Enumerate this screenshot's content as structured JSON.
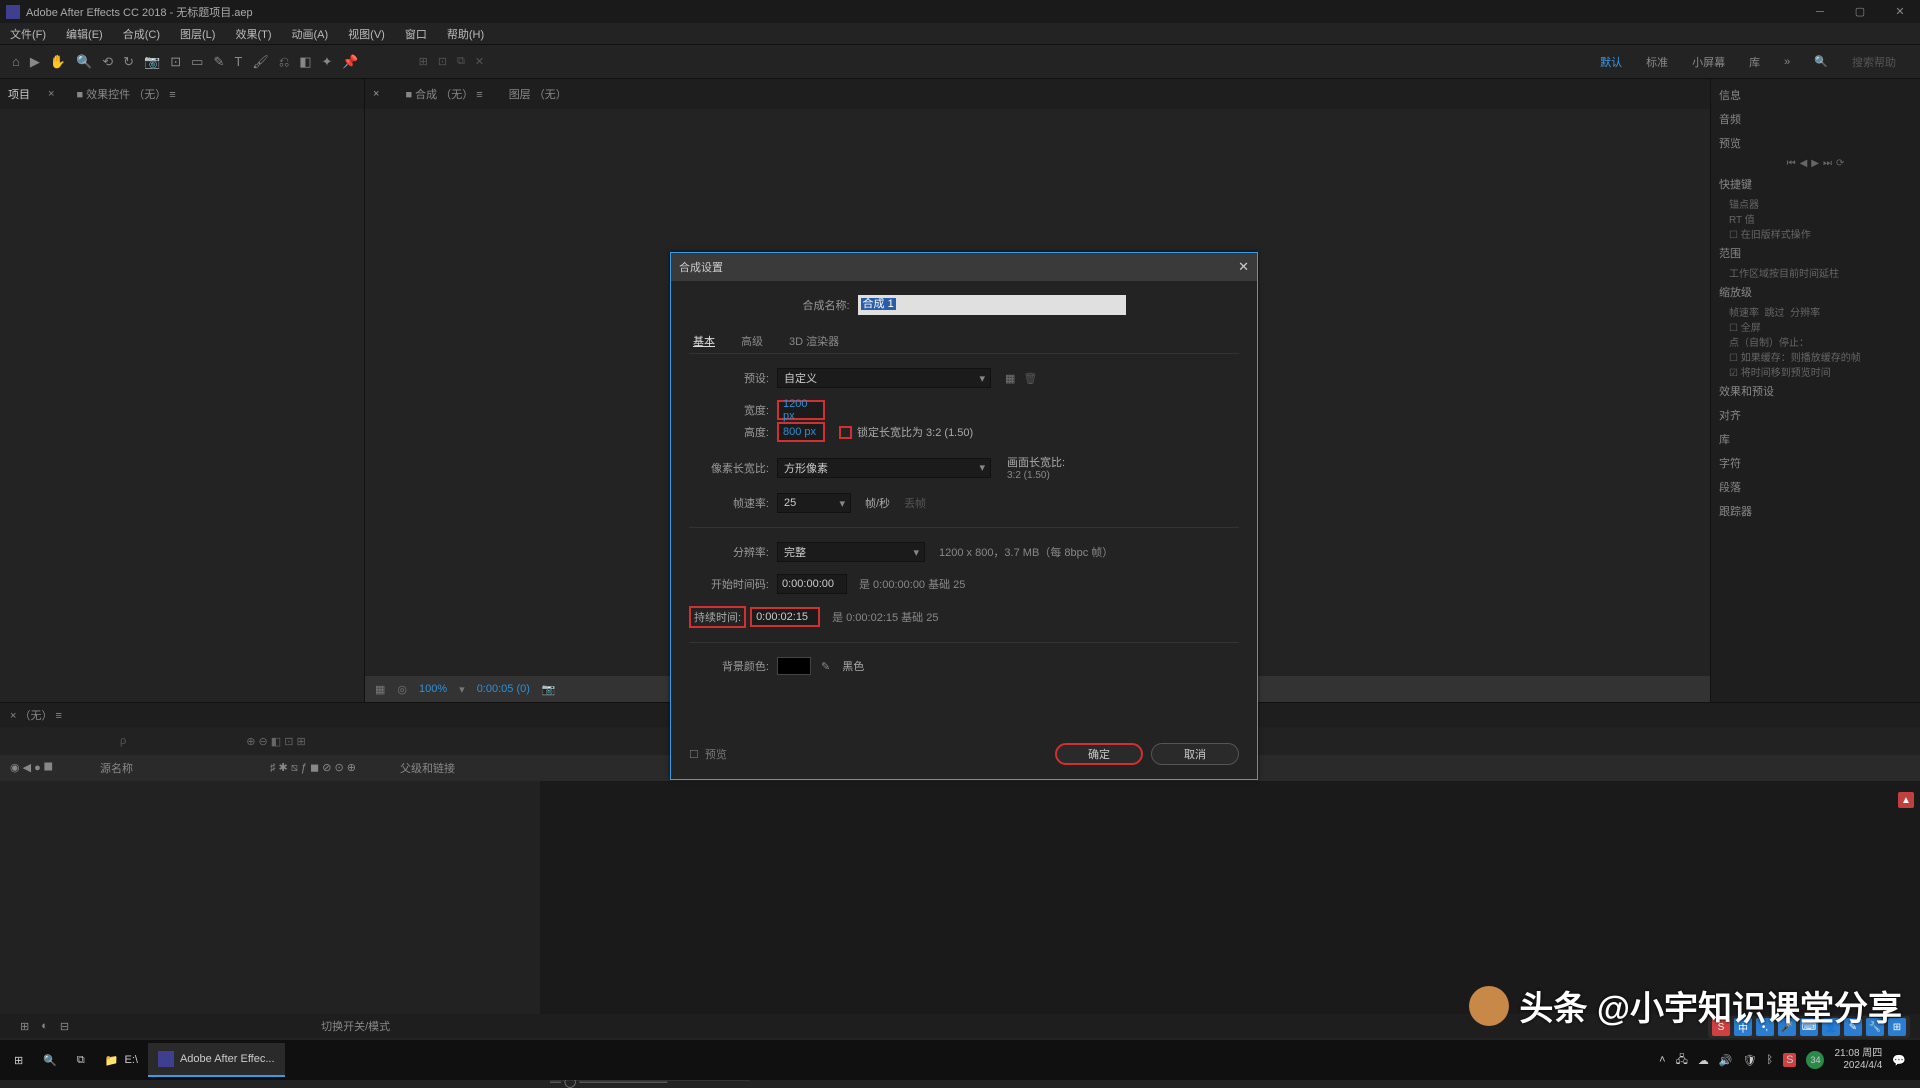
{
  "titlebar": {
    "title": "Adobe After Effects CC 2018 - 无标题项目.aep"
  },
  "menu": [
    "文件(F)",
    "编辑(E)",
    "合成(C)",
    "图层(L)",
    "效果(T)",
    "动画(A)",
    "视图(V)",
    "窗口",
    "帮助(H)"
  ],
  "workspace": {
    "items": [
      "默认",
      "标准",
      "小屏幕",
      "库"
    ],
    "active_idx": 0,
    "search_placeholder": "搜索帮助"
  },
  "panels": {
    "project_tab": "项目",
    "effects_tab": "效果控件 （无）",
    "comp_tab": "合成 （无）",
    "layer_tab": "图层 （无）",
    "footer_zoom": "100%",
    "footer_time": "0:00:05 (0)"
  },
  "right_panel": {
    "items": [
      "信息",
      "音频",
      "预览",
      "效果和预设",
      "对齐",
      "库",
      "字符",
      "段落",
      "跟踪器"
    ],
    "play_controls": [
      "⏮",
      "◀",
      "▶",
      "⏭",
      "⟳"
    ],
    "section_anchor": "锚点器",
    "quick_key": "快捷键",
    "rt_label": "RT 值",
    "cb_old_style": "在旧版样式操作",
    "section_scope": "范围",
    "scope_hint": "工作区域按目前时间延柱",
    "section_zoom": "缩放级",
    "frame_rate": "帧速率",
    "skip_label": "跳过",
    "resolution": "分辨率",
    "cb_fullscreen": "全屏",
    "dot_label": "点（自制）停止：",
    "cb_cache_prefix": "如果缓存：则播放缓存的帧",
    "cb_move_time": "将时间移到预览时间"
  },
  "timeline": {
    "tab": "（无）",
    "search_placeholder": "ρ",
    "col_source": "源名称",
    "col_switches": "♯ ✱ ⧅ ƒ ◼ ⊘ ⊙ ⊕",
    "col_parent": "父级和链接",
    "footer_switch": "切换开关/模式"
  },
  "dialog": {
    "title": "合成设置",
    "name_label": "合成名称:",
    "name_value": "合成 1",
    "tabs": [
      "基本",
      "高级",
      "3D 渲染器"
    ],
    "preset_label": "预设:",
    "preset_value": "自定义",
    "width_label": "宽度:",
    "width_value": "1200 px",
    "height_label": "高度:",
    "height_value": "800 px",
    "lock_ratio": "锁定长宽比为 3:2 (1.50)",
    "par_label": "像素长宽比:",
    "par_value": "方形像素",
    "frame_ratio_label": "画面长宽比:",
    "frame_ratio_value": "3:2 (1.50)",
    "fps_label": "帧速率:",
    "fps_value": "25",
    "fps_unit": "帧/秒",
    "fps_drop": "丢帧",
    "res_label": "分辨率:",
    "res_value": "完整",
    "res_info": "1200 x 800，3.7 MB（每 8bpc 帧）",
    "start_label": "开始时间码:",
    "start_value": "0:00:00:00",
    "start_info": "是 0:00:00:00 基础 25",
    "dur_label": "持续时间:",
    "dur_value": "0:00:02:15",
    "dur_info": "是 0:00:02:15 基础 25",
    "bg_label": "背景颜色:",
    "bg_name": "黑色",
    "preview": "预览",
    "ok": "确定",
    "cancel": "取消"
  },
  "taskbar": {
    "explorer": "E:\\",
    "ae": "Adobe After Effec...",
    "tray_temp": "34",
    "time": "21:08 周四",
    "date": "2024/4/4"
  },
  "watermark": "头条 @小宇知识课堂分享"
}
